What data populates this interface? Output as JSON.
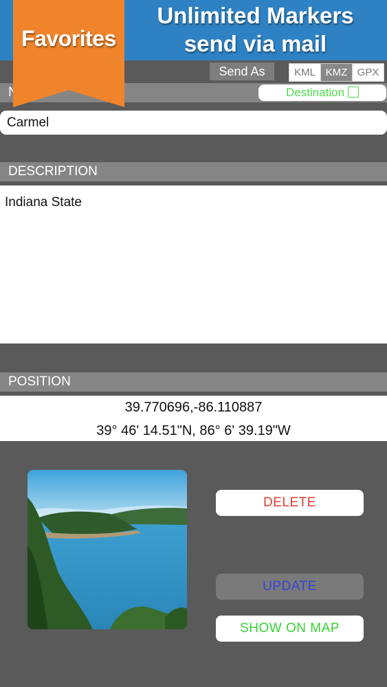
{
  "banner": {
    "line1": "Unlimited Markers",
    "line2": "send via mail",
    "ribbon": "Favorites",
    "colors": {
      "banner": "#2e82c4",
      "ribbon": "#f0842a"
    }
  },
  "send_as": {
    "label": "Send As",
    "formats": [
      "KML",
      "KMZ",
      "GPX"
    ],
    "selected": "KMZ"
  },
  "name_section": {
    "header": "NAME",
    "destination_label": "Destination",
    "destination_checked": false,
    "value": "Carmel"
  },
  "description_section": {
    "header": "DESCRIPTION",
    "value": "Indiana State"
  },
  "position_section": {
    "header": "POSITION",
    "decimal": "39.770696,-86.110887",
    "dms": "39° 46' 14.51\"N, 86° 6' 39.19\"W"
  },
  "actions": {
    "delete": "DELETE",
    "update": "UPDATE",
    "show_on_map": "SHOW ON MAP"
  }
}
